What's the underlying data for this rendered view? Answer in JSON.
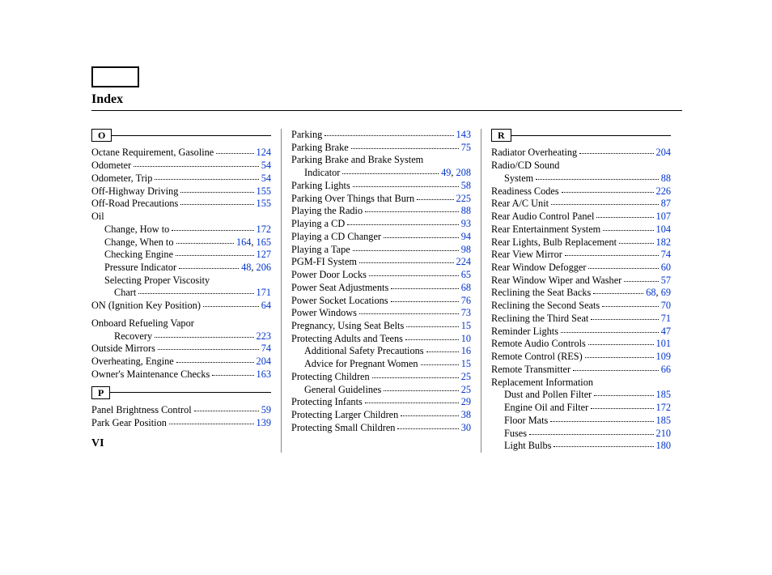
{
  "title": "Index",
  "footer": "VI",
  "letters": {
    "O": "O",
    "P": "P",
    "R": "R"
  },
  "col1": [
    {
      "t": "letter",
      "key": "O"
    },
    {
      "t": "entry",
      "label": "Octane Requirement, Gasoline",
      "pages": [
        "124"
      ]
    },
    {
      "t": "entry",
      "label": "Odometer",
      "pages": [
        "54"
      ]
    },
    {
      "t": "entry",
      "label": "Odometer, Trip",
      "pages": [
        "54"
      ]
    },
    {
      "t": "entry",
      "label": "Off-Highway Driving",
      "pages": [
        "155"
      ]
    },
    {
      "t": "entry",
      "label": "Off-Road Precautions",
      "pages": [
        "155"
      ]
    },
    {
      "t": "plain",
      "label": "Oil"
    },
    {
      "t": "entry",
      "indent": 1,
      "label": "Change, How to",
      "pages": [
        "172"
      ]
    },
    {
      "t": "entry",
      "indent": 1,
      "label": "Change, When to",
      "pages": [
        "164",
        "165"
      ]
    },
    {
      "t": "entry",
      "indent": 1,
      "label": "Checking Engine",
      "pages": [
        "127"
      ]
    },
    {
      "t": "entry",
      "indent": 1,
      "label": "Pressure Indicator",
      "pages": [
        "48",
        "206"
      ]
    },
    {
      "t": "plain",
      "indent": 1,
      "label": "Selecting Proper Viscosity"
    },
    {
      "t": "entry",
      "indent": 2,
      "label": "Chart",
      "pages": [
        "171"
      ]
    },
    {
      "t": "entry",
      "label": "ON (Ignition Key Position)",
      "pages": [
        "64"
      ]
    },
    {
      "t": "gap"
    },
    {
      "t": "plain",
      "label": "Onboard Refueling Vapor"
    },
    {
      "t": "entry",
      "indent": 2,
      "label": "Recovery",
      "pages": [
        "223"
      ]
    },
    {
      "t": "entry",
      "label": "Outside Mirrors",
      "pages": [
        "74"
      ]
    },
    {
      "t": "entry",
      "label": "Overheating, Engine",
      "pages": [
        "204"
      ]
    },
    {
      "t": "entry",
      "label": "Owner's Maintenance Checks",
      "pages": [
        "163"
      ]
    },
    {
      "t": "gap"
    },
    {
      "t": "letter",
      "key": "P"
    },
    {
      "t": "entry",
      "label": "Panel Brightness Control",
      "pages": [
        "59"
      ]
    },
    {
      "t": "entry",
      "label": "Park Gear Position",
      "pages": [
        "139"
      ]
    }
  ],
  "col2": [
    {
      "t": "entry",
      "label": "Parking",
      "pages": [
        "143"
      ]
    },
    {
      "t": "entry",
      "label": "Parking Brake",
      "pages": [
        "75"
      ]
    },
    {
      "t": "plain",
      "label": "Parking Brake and Brake System"
    },
    {
      "t": "entry",
      "indent": 1,
      "label": "Indicator",
      "pages": [
        "49",
        "208"
      ]
    },
    {
      "t": "entry",
      "label": "Parking Lights",
      "pages": [
        "58"
      ]
    },
    {
      "t": "entry",
      "label": "Parking Over Things that Burn",
      "pages": [
        "225"
      ]
    },
    {
      "t": "entry",
      "label": "Playing the Radio",
      "pages": [
        "88"
      ]
    },
    {
      "t": "entry",
      "label": "Playing a CD",
      "pages": [
        "93"
      ]
    },
    {
      "t": "entry",
      "label": "Playing a CD Changer",
      "pages": [
        "94"
      ]
    },
    {
      "t": "entry",
      "label": "Playing a Tape",
      "pages": [
        "98"
      ]
    },
    {
      "t": "entry",
      "label": "PGM-FI System",
      "pages": [
        "224"
      ]
    },
    {
      "t": "entry",
      "label": "Power Door Locks",
      "pages": [
        "65"
      ]
    },
    {
      "t": "entry",
      "label": "Power Seat Adjustments",
      "pages": [
        "68"
      ]
    },
    {
      "t": "entry",
      "label": "Power Socket Locations",
      "pages": [
        "76"
      ]
    },
    {
      "t": "entry",
      "label": "Power Windows",
      "pages": [
        "73"
      ]
    },
    {
      "t": "entry",
      "label": "Pregnancy, Using Seat Belts",
      "pages": [
        "15"
      ]
    },
    {
      "t": "entry",
      "label": "Protecting Adults and Teens",
      "pages": [
        "10"
      ]
    },
    {
      "t": "entry",
      "indent": 1,
      "label": "Additional Safety Precautions",
      "pages": [
        "16"
      ]
    },
    {
      "t": "entry",
      "indent": 1,
      "label": "Advice for Pregnant Women",
      "pages": [
        "15"
      ]
    },
    {
      "t": "entry",
      "label": "Protecting Children",
      "pages": [
        "25"
      ]
    },
    {
      "t": "entry",
      "indent": 1,
      "label": "General Guidelines",
      "pages": [
        "25"
      ]
    },
    {
      "t": "entry",
      "label": "Protecting Infants",
      "pages": [
        "29"
      ]
    },
    {
      "t": "entry",
      "label": "Protecting Larger Children",
      "pages": [
        "38"
      ]
    },
    {
      "t": "entry",
      "label": "Protecting Small Children",
      "pages": [
        "30"
      ]
    }
  ],
  "col3": [
    {
      "t": "letter",
      "key": "R"
    },
    {
      "t": "entry",
      "label": "Radiator Overheating",
      "pages": [
        "204"
      ]
    },
    {
      "t": "plain",
      "label": "Radio/CD Sound"
    },
    {
      "t": "entry",
      "indent": 1,
      "label": "System",
      "pages": [
        "88"
      ]
    },
    {
      "t": "entry",
      "label": "Readiness Codes",
      "pages": [
        "226"
      ]
    },
    {
      "t": "entry",
      "label": "Rear A/C Unit",
      "pages": [
        "87"
      ]
    },
    {
      "t": "entry",
      "label": "Rear Audio Control Panel",
      "pages": [
        "107"
      ]
    },
    {
      "t": "entry",
      "label": "Rear Entertainment System",
      "pages": [
        "104"
      ]
    },
    {
      "t": "entry",
      "label": "Rear Lights, Bulb Replacement",
      "pages": [
        "182"
      ]
    },
    {
      "t": "entry",
      "label": "Rear View Mirror",
      "pages": [
        "74"
      ]
    },
    {
      "t": "entry",
      "label": "Rear Window Defogger",
      "pages": [
        "60"
      ]
    },
    {
      "t": "entry",
      "label": "Rear Window Wiper and Washer",
      "pages": [
        "57"
      ]
    },
    {
      "t": "entry",
      "label": "Reclining the Seat Backs",
      "pages": [
        "68",
        "69"
      ]
    },
    {
      "t": "entry",
      "label": "Reclining the Second Seats",
      "pages": [
        "70"
      ]
    },
    {
      "t": "entry",
      "label": "Reclining the Third Seat",
      "pages": [
        "71"
      ]
    },
    {
      "t": "entry",
      "label": "Reminder Lights",
      "pages": [
        "47"
      ]
    },
    {
      "t": "entry",
      "label": "Remote Audio Controls",
      "pages": [
        "101"
      ]
    },
    {
      "t": "entry",
      "label": "Remote Control (RES)",
      "pages": [
        "109"
      ]
    },
    {
      "t": "entry",
      "label": "Remote Transmitter",
      "pages": [
        "66"
      ]
    },
    {
      "t": "plain",
      "label": "Replacement Information"
    },
    {
      "t": "entry",
      "indent": 1,
      "label": "Dust and Pollen Filter",
      "pages": [
        "185"
      ]
    },
    {
      "t": "entry",
      "indent": 1,
      "label": "Engine Oil and Filter",
      "pages": [
        "172"
      ]
    },
    {
      "t": "entry",
      "indent": 1,
      "label": "Floor Mats",
      "pages": [
        "185"
      ]
    },
    {
      "t": "entry",
      "indent": 1,
      "label": "Fuses",
      "pages": [
        "210"
      ]
    },
    {
      "t": "entry",
      "indent": 1,
      "label": "Light Bulbs",
      "pages": [
        "180"
      ]
    }
  ]
}
